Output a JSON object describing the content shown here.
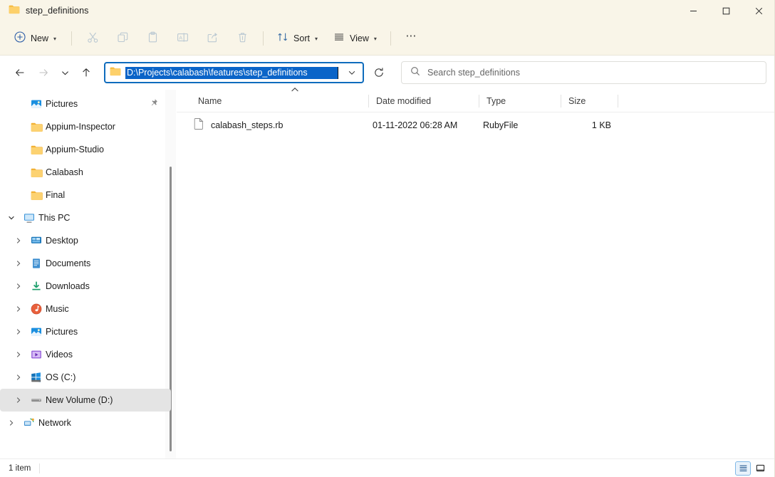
{
  "window": {
    "tab_title": "step_definitions",
    "folder_icon": "folder-icon",
    "controls": {
      "minimize": "Minimize",
      "maximize": "Maximize",
      "close": "Close"
    }
  },
  "toolbar": {
    "new_label": "New",
    "cut_label": "Cut",
    "copy_label": "Copy",
    "paste_label": "Paste",
    "rename_label": "Rename",
    "share_label": "Share",
    "delete_label": "Delete",
    "sort_label": "Sort",
    "view_label": "View",
    "more_label": "See more"
  },
  "nav": {
    "back_label": "Back",
    "forward_label": "Forward",
    "recent_label": "Recent locations",
    "up_label": "Up to Parent",
    "refresh_label": "Refresh",
    "address_value": "D:\\Projects\\calabash\\features\\step_definitions",
    "address_dropdown_label": "Previous locations"
  },
  "search": {
    "placeholder": "Search step_definitions",
    "icon": "search-icon"
  },
  "sidebar": {
    "quick_access": [
      {
        "label": "Pictures",
        "icon": "pictures-icon",
        "twisty": "",
        "pinned": true,
        "selected": false
      },
      {
        "label": "Appium-Inspector",
        "icon": "folder-icon",
        "twisty": "",
        "pinned": false,
        "selected": false
      },
      {
        "label": "Appium-Studio",
        "icon": "folder-icon",
        "twisty": "",
        "pinned": false,
        "selected": false
      },
      {
        "label": "Calabash",
        "icon": "folder-icon",
        "twisty": "",
        "pinned": false,
        "selected": false
      },
      {
        "label": "Final",
        "icon": "folder-icon",
        "twisty": "",
        "pinned": false,
        "selected": false
      }
    ],
    "this_pc": {
      "label": "This PC",
      "icon": "monitor-icon",
      "twisty": "expanded",
      "selected": false
    },
    "this_pc_children": [
      {
        "label": "Desktop",
        "icon": "desktop-icon",
        "twisty": "collapsed",
        "selected": false
      },
      {
        "label": "Documents",
        "icon": "documents-icon",
        "twisty": "collapsed",
        "selected": false
      },
      {
        "label": "Downloads",
        "icon": "downloads-icon",
        "twisty": "collapsed",
        "selected": false
      },
      {
        "label": "Music",
        "icon": "music-icon",
        "twisty": "collapsed",
        "selected": false
      },
      {
        "label": "Pictures",
        "icon": "pictures-icon",
        "twisty": "collapsed",
        "selected": false
      },
      {
        "label": "Videos",
        "icon": "videos-icon",
        "twisty": "collapsed",
        "selected": false
      },
      {
        "label": "OS (C:)",
        "icon": "windows-drive-icon",
        "twisty": "collapsed",
        "selected": false
      },
      {
        "label": "New Volume (D:)",
        "icon": "drive-icon",
        "twisty": "collapsed",
        "selected": true
      }
    ],
    "network": {
      "label": "Network",
      "icon": "network-icon",
      "twisty": "collapsed",
      "selected": false
    }
  },
  "filelist": {
    "columns": [
      {
        "key": "name",
        "label": "Name",
        "sorted": "ascending"
      },
      {
        "key": "date",
        "label": "Date modified",
        "sorted": ""
      },
      {
        "key": "type",
        "label": "Type",
        "sorted": ""
      },
      {
        "key": "size",
        "label": "Size",
        "sorted": ""
      }
    ],
    "rows": [
      {
        "name": "calabash_steps.rb",
        "date": "01-11-2022 06:28 AM",
        "type": "RubyFile",
        "size": "1 KB",
        "icon": "file-icon"
      }
    ]
  },
  "statusbar": {
    "item_count": "1 item",
    "details_view_label": "Details view",
    "large_icons_view_label": "Large icons view",
    "active_view": "details"
  },
  "colors": {
    "titlebar_bg": "#f9f5e8",
    "toolbar_bg": "#f9f5e8",
    "accent": "#0f6cbd",
    "selection_blue": "#0a64c8",
    "sidebar_selected": "#e4e4e4",
    "folder_yellow": "#ffc95c"
  }
}
